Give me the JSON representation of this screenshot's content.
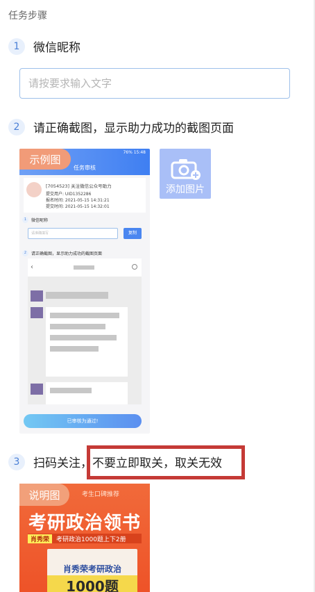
{
  "section_title": "任务步骤",
  "steps": [
    {
      "num": "1",
      "text": "微信昵称"
    },
    {
      "num": "2",
      "text": "请正确截图，显示助力成功的截图页面"
    },
    {
      "num": "3",
      "text": "扫码关注，不要立即取关，取关无效"
    }
  ],
  "nickname_input": {
    "placeholder": "请按要求输入文字",
    "value": ""
  },
  "example": {
    "badge": "示例图",
    "status": "76% 15:48",
    "title": "任务审核",
    "task_line": "[7054523] 关注微信公众号助力",
    "submitter": "提交用户: UID1352286",
    "signup_time": "报名时间: 2021-05-15 14:31:21",
    "submit_time": "提交时间: 2021-05-15 14:32:01",
    "sub1_num": "1",
    "sub1": "微信昵称",
    "input_placeholder": "请准确填写",
    "copy_button": "复制",
    "sub2_num": "2",
    "sub2": "请正确截图，显示助力成功的截图页面",
    "bottom_button": "已审核为通过!"
  },
  "add_image": {
    "label": "添加图片",
    "icon": "camera-plus-icon"
  },
  "promo": {
    "badge": "说明图",
    "tag": "考生口碑推荐",
    "headline": "考研政治领书",
    "author": "肖秀荣",
    "subtitle": "考研政治1000题上下2册",
    "book_title": "肖秀荣考研政治",
    "book_number": "1000题"
  },
  "colors": {
    "accent": "#4a7fd6",
    "highlight_border": "#c53a36",
    "promo_bg": "#ee5328"
  }
}
